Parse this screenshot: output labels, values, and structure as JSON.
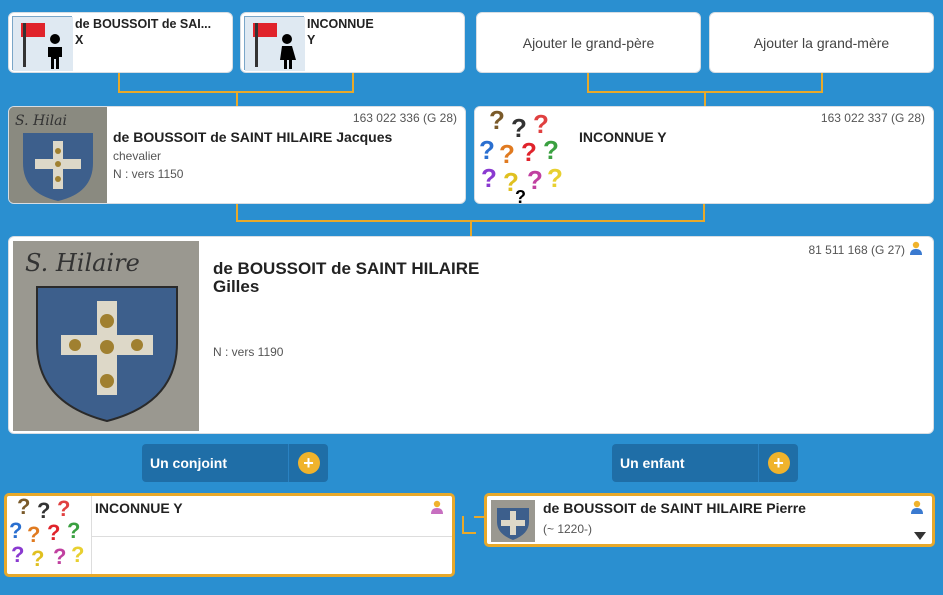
{
  "grandparents": {
    "paternal_grandfather": {
      "name": "de BOUSSOIT de SAI...",
      "given": "X"
    },
    "paternal_grandmother": {
      "name": "INCONNUE",
      "given": "Y"
    },
    "add_grandfather": "Ajouter le grand-père",
    "add_grandmother": "Ajouter la grand-mère"
  },
  "parents": {
    "father": {
      "sosa": "163 022 336 (G 28)",
      "name": "de BOUSSOIT de SAINT HILAIRE Jacques",
      "title": "chevalier",
      "birth": "N : vers 1150"
    },
    "mother": {
      "sosa": "163 022 337 (G 28)",
      "name": "INCONNUE Y"
    }
  },
  "main": {
    "sosa": "81 511 168 (G 27)",
    "surname": "de BOUSSOIT de SAINT HILAIRE",
    "given": "Gilles",
    "birth": "N : vers 1190",
    "image_caption": "S. Hilaire"
  },
  "actions": {
    "spouse": "Un conjoint",
    "child": "Un enfant",
    "plus": "+"
  },
  "spouse": {
    "name": "INCONNUE Y"
  },
  "child": {
    "name": "de BOUSSOIT de SAINT HILAIRE Pierre",
    "dates": "(~ 1220-)"
  },
  "colors": {
    "background": "#2a8fd0",
    "connector": "#e8a92a",
    "male": "#3a7ad0",
    "female": "#c76fc0",
    "button": "#1f6ea7"
  },
  "icons": {
    "male_silhouette": "male-icon",
    "female_silhouette": "female-icon",
    "unknown": "question-marks-icon",
    "plus": "plus-icon"
  }
}
